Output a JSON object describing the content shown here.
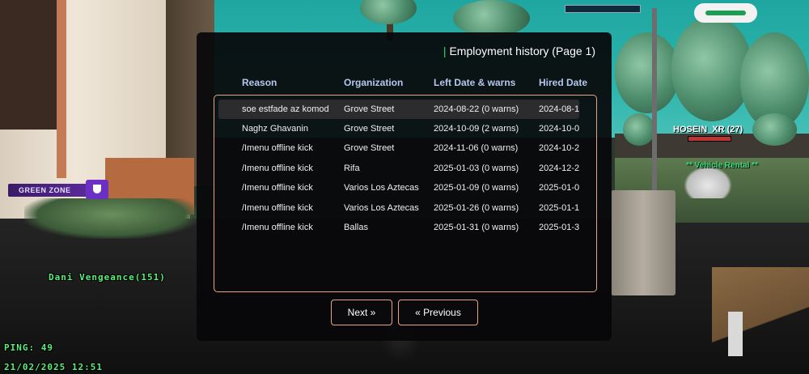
{
  "dialog": {
    "title": "Employment history (Page 1)",
    "columns": [
      "Reason",
      "Organization",
      "Left Date & warns",
      "Hired Date"
    ],
    "rows": [
      {
        "reason": "soe estfade az komod",
        "organization": "Grove Street",
        "left": "2024-08-22 (0 warns)",
        "hired": "2024-08-1"
      },
      {
        "reason": "Naghz Ghavanin",
        "organization": "Grove Street",
        "left": "2024-10-09 (2 warns)",
        "hired": "2024-10-0"
      },
      {
        "reason": "/Imenu offline kick",
        "organization": "Grove Street",
        "left": "2024-11-06 (0 warns)",
        "hired": "2024-10-2"
      },
      {
        "reason": "/Imenu offline kick",
        "organization": "Rifa",
        "left": "2025-01-03 (0 warns)",
        "hired": "2024-12-2"
      },
      {
        "reason": "/Imenu offline kick",
        "organization": "Varios Los Aztecas",
        "left": "2025-01-09 (0 warns)",
        "hired": "2025-01-0"
      },
      {
        "reason": "/Imenu offline kick",
        "organization": "Varios Los Aztecas",
        "left": "2025-01-26 (0 warns)",
        "hired": "2025-01-1"
      },
      {
        "reason": "/Imenu offline kick",
        "organization": "Ballas",
        "left": "2025-01-31 (0 warns)",
        "hired": "2025-01-3"
      }
    ],
    "next_label": "Next »",
    "previous_label": "« Previous"
  },
  "hud": {
    "zone_label": "GREEN ZONE",
    "player_name": "Dani Vengeance(151)",
    "ping": "PING: 49",
    "datetime": "21/02/2025 12:51",
    "other_player": "HOSEIN_XR (27)",
    "vehicle_rental": "** Vehicle Rental **"
  },
  "colors": {
    "accent_green": "#2fd46a",
    "hud_green": "#5cf07a",
    "border_salmon": "#e8a687",
    "header_blue": "#b6c8ec"
  }
}
